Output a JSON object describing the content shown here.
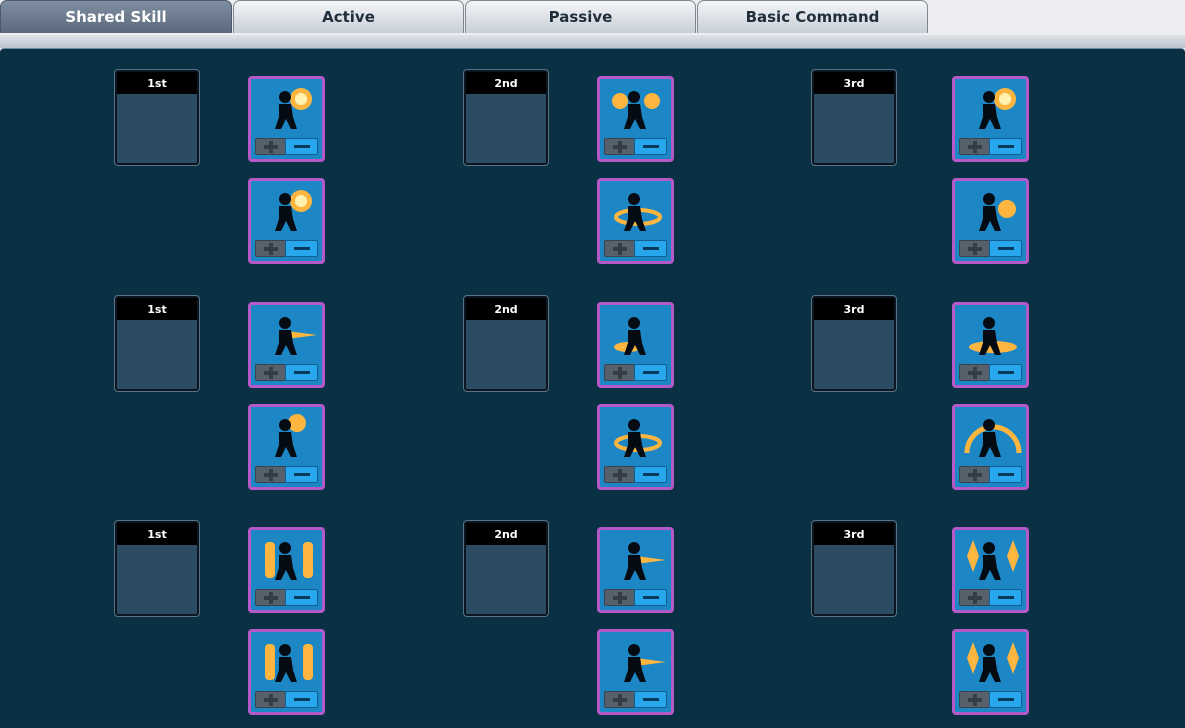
{
  "tabs": [
    {
      "label": "Shared Skill",
      "active": true
    },
    {
      "label": "Active",
      "active": false
    },
    {
      "label": "Passive",
      "active": false
    },
    {
      "label": "Basic Command",
      "active": false
    }
  ],
  "rows": [
    {
      "slots": [
        {
          "label": "1st"
        },
        {
          "label": "2nd"
        },
        {
          "label": "3rd"
        }
      ],
      "skills": [
        {
          "icon": "silhouette-fire-burst-icon"
        },
        {
          "icon": "silhouette-fire-burst-icon"
        },
        {
          "icon": "silhouette-dual-fire-fists-icon"
        },
        {
          "icon": "silhouette-flame-spin-icon"
        },
        {
          "icon": "silhouette-explosion-icon"
        },
        {
          "icon": "silhouette-fire-punch-icon"
        }
      ]
    },
    {
      "slots": [
        {
          "label": "1st"
        },
        {
          "label": "2nd"
        },
        {
          "label": "3rd"
        }
      ],
      "skills": [
        {
          "icon": "silhouette-fire-dash-icon"
        },
        {
          "icon": "silhouette-flame-uppercut-icon"
        },
        {
          "icon": "silhouette-slide-kick-icon"
        },
        {
          "icon": "silhouette-fire-slash-icon"
        },
        {
          "icon": "silhouette-ground-flame-icon"
        },
        {
          "icon": "silhouette-flame-dome-icon"
        }
      ]
    },
    {
      "slots": [
        {
          "label": "1st"
        },
        {
          "label": "2nd"
        },
        {
          "label": "3rd"
        }
      ],
      "skills": [
        {
          "icon": "silhouette-flame-pillars-icon"
        },
        {
          "icon": "silhouette-flame-pillars-icon"
        },
        {
          "icon": "silhouette-fire-beam-icon"
        },
        {
          "icon": "silhouette-fire-beam-icon"
        },
        {
          "icon": "silhouette-energy-crystals-icon"
        },
        {
          "icon": "silhouette-energy-crystals-icon"
        }
      ]
    }
  ],
  "colors": {
    "panel_bg": "#0a3044",
    "skill_bg": "#1d86c4",
    "skill_border": "#b559c8",
    "minus_button": "#29a7ec",
    "plus_button": "#56616c",
    "flame": "#ffb640"
  }
}
